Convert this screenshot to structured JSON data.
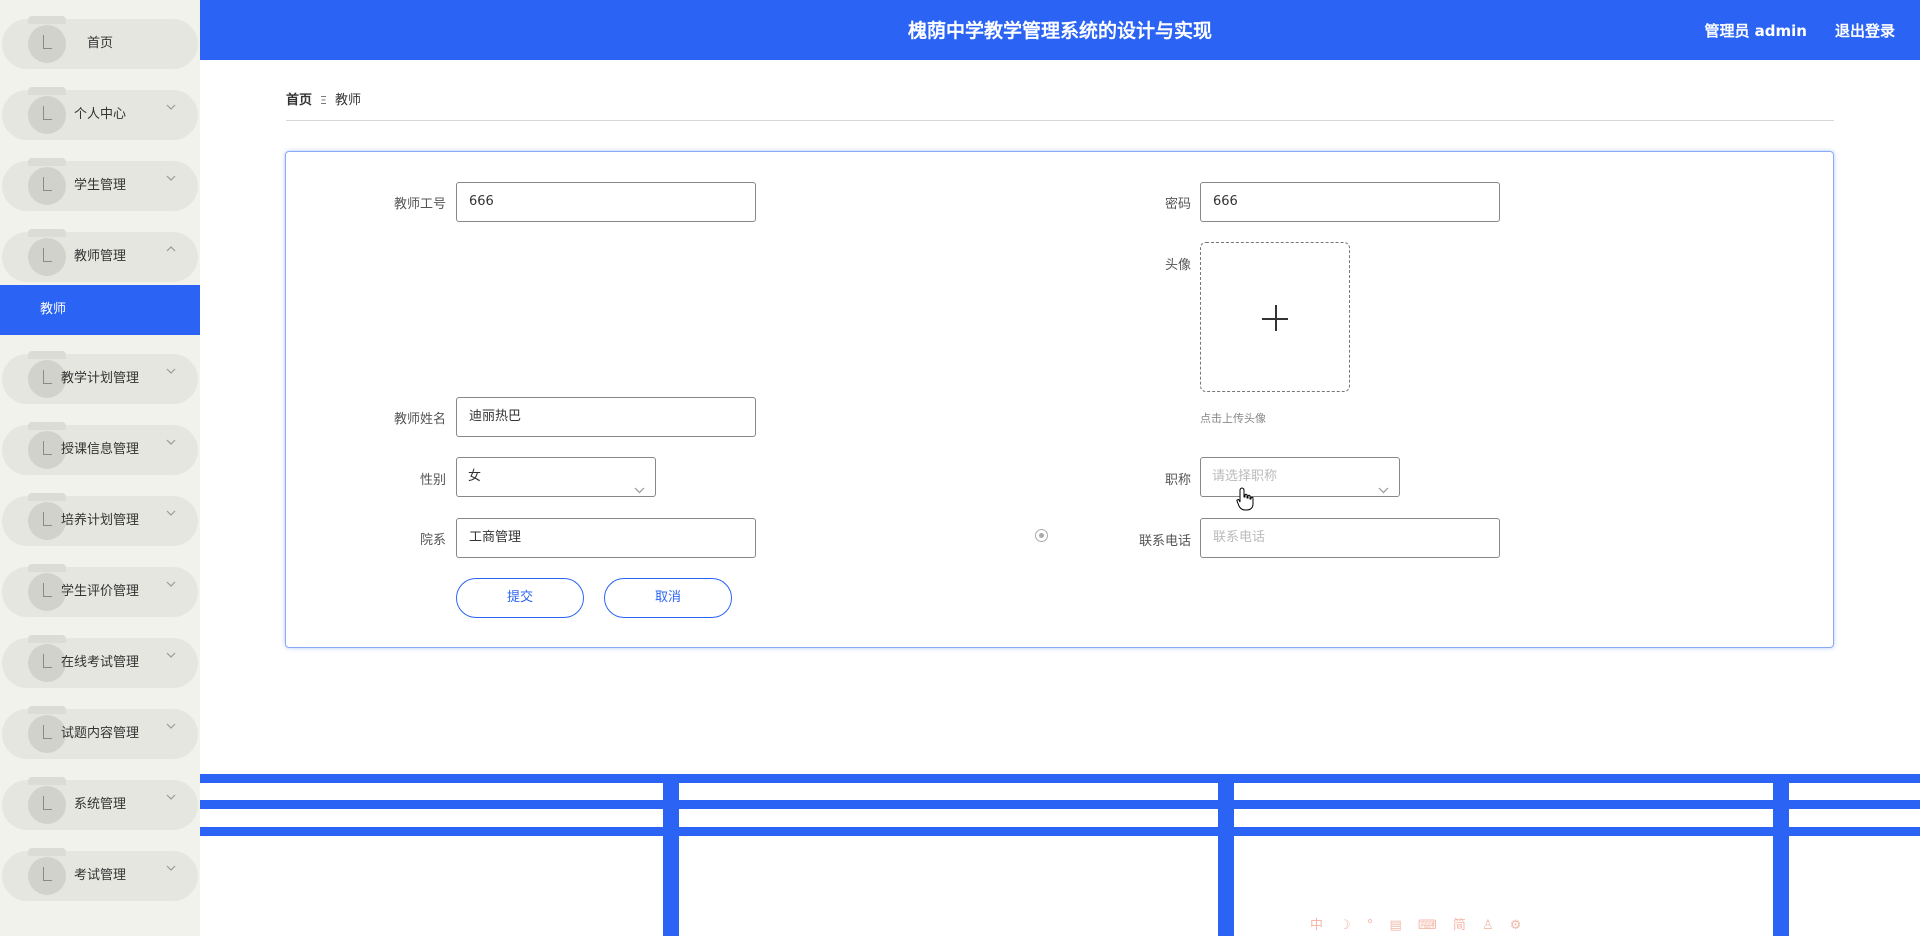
{
  "header": {
    "title": "槐荫中学教学管理系统的设计与实现",
    "user_info": "管理员 admin",
    "logout_label": "退出登录"
  },
  "sidebar": {
    "items": [
      {
        "label": "首页",
        "has_chevron": false
      },
      {
        "label": "个人中心",
        "has_chevron": true
      },
      {
        "label": "学生管理",
        "has_chevron": true
      },
      {
        "label": "教师管理",
        "has_chevron": true,
        "expanded": true
      },
      {
        "label": "教学计划管理",
        "has_chevron": true
      },
      {
        "label": "授课信息管理",
        "has_chevron": true
      },
      {
        "label": "培养计划管理",
        "has_chevron": true
      },
      {
        "label": "学生评价管理",
        "has_chevron": true
      },
      {
        "label": "在线考试管理",
        "has_chevron": true
      },
      {
        "label": "试题内容管理",
        "has_chevron": true
      },
      {
        "label": "系统管理",
        "has_chevron": true
      },
      {
        "label": "考试管理",
        "has_chevron": true
      }
    ],
    "active_subitem": "教师"
  },
  "breadcrumb": {
    "home": "首页",
    "separator": "Ξ",
    "current": "教师"
  },
  "form": {
    "teacher_id": {
      "label": "教师工号",
      "value": "666"
    },
    "password": {
      "label": "密码",
      "value": "666"
    },
    "avatar": {
      "label": "头像",
      "hint": "点击上传头像"
    },
    "teacher_name": {
      "label": "教师姓名",
      "value": "迪丽热巴"
    },
    "gender": {
      "label": "性别",
      "value": "女"
    },
    "title": {
      "label": "职称",
      "placeholder": "请选择职称"
    },
    "department": {
      "label": "院系",
      "value": "工商管理"
    },
    "phone": {
      "label": "联系电话",
      "placeholder": "联系电话"
    },
    "submit_label": "提交",
    "cancel_label": "取消"
  },
  "colors": {
    "accent": "#2b64f4",
    "sidebar_bg": "#f2f2ec",
    "menu_item_bg": "#e6e6e0"
  },
  "ime_toolbar": "中 ☽ ° ▤ ⌨ 简 ♙ ⚙"
}
